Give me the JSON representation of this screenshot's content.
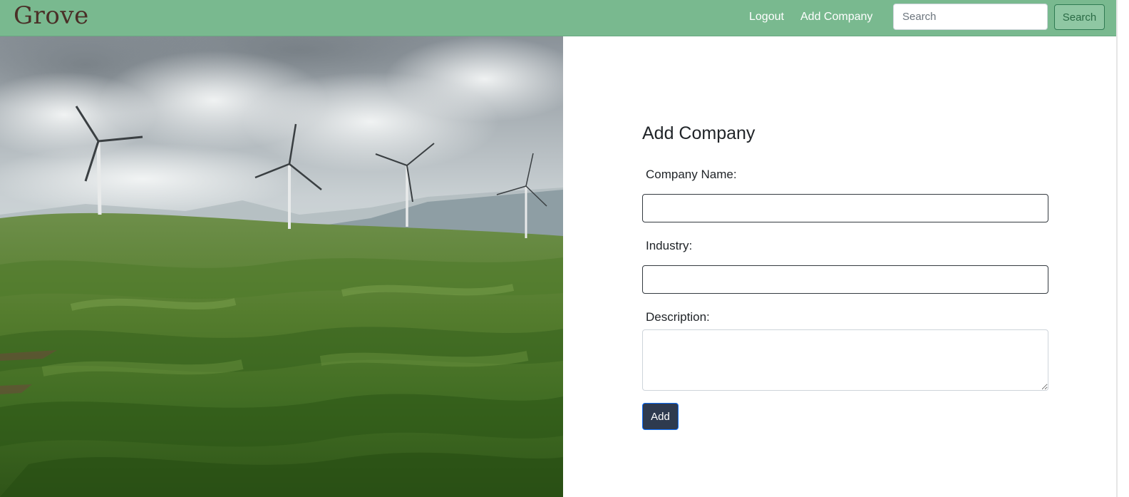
{
  "navbar": {
    "brand": "Grove",
    "links": {
      "logout": "Logout",
      "add_company": "Add Company"
    },
    "search": {
      "placeholder": "Search",
      "value": "",
      "button_label": "Search"
    }
  },
  "hero": {
    "alt": "Wind turbines on rolling green hills"
  },
  "form": {
    "title": "Add Company",
    "fields": {
      "company_name": {
        "label": "Company Name:",
        "value": ""
      },
      "industry": {
        "label": "Industry:",
        "value": ""
      },
      "description": {
        "label": "Description:",
        "value": ""
      }
    },
    "submit_label": "Add"
  },
  "colors": {
    "navbar_bg": "#79b98f",
    "brand_text": "#4a2f27",
    "search_button_bg": "#8fc7a3",
    "submit_button_bg": "#2e3a4f"
  }
}
